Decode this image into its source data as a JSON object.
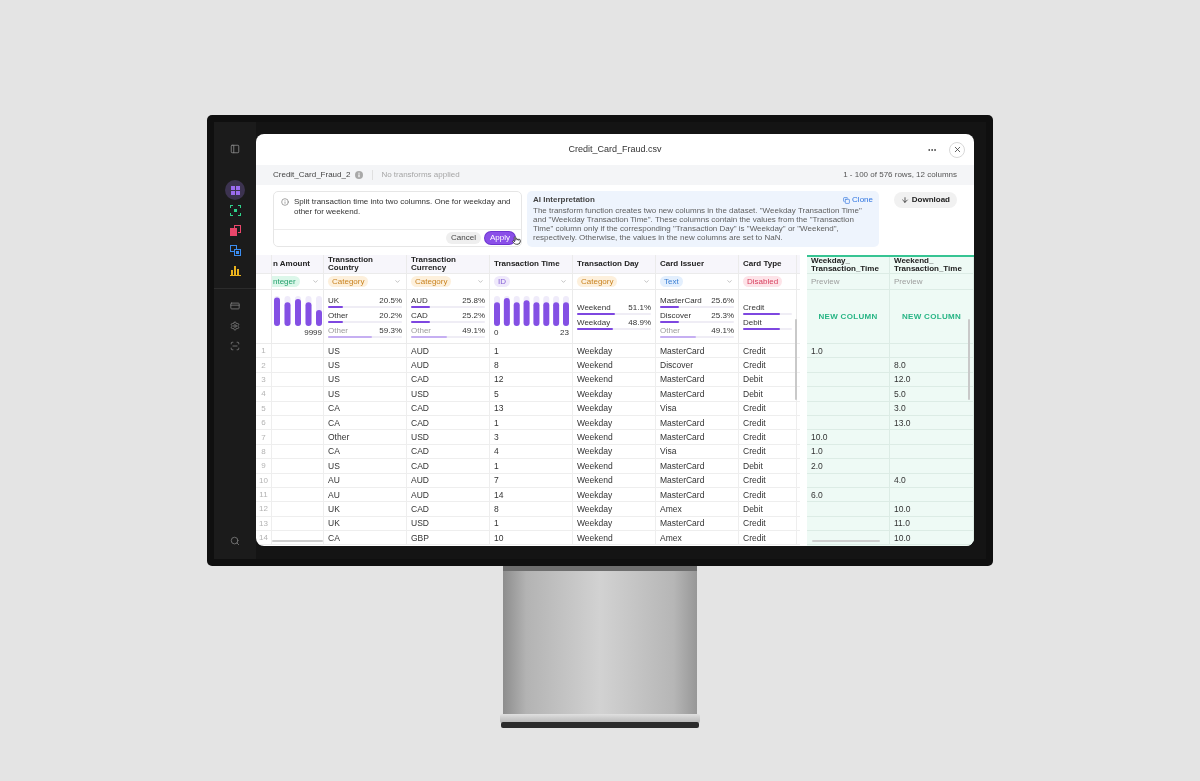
{
  "sidebar": {
    "apps": [
      {
        "selected": true,
        "color": "#9b6cf0"
      },
      {
        "selected": false,
        "color": "#2fd28a"
      },
      {
        "selected": false,
        "color": "#e8466a"
      },
      {
        "selected": false,
        "color": "#3b8df0"
      },
      {
        "selected": false,
        "color": "#e9b21d"
      }
    ]
  },
  "dialog": {
    "title": "Credit_Card_Fraud.csv"
  },
  "dataset_bar": {
    "name": "Credit_Card_Fraud_2",
    "status": "No transforms applied",
    "summary": "1 - 100 of 576 rows, 12 columns"
  },
  "prompt": {
    "text": "Split transaction time into two columns. One for weekday and other for weekend.",
    "buttons": [
      {
        "label": "Cancel",
        "kind": "secondary"
      },
      {
        "label": "Apply",
        "kind": "primary"
      }
    ]
  },
  "ai_interpretation": {
    "title": "AI Interpretation",
    "action": "Clone",
    "text": "The transform function creates two new columns in the dataset. \"Weekday Transaction Time\" and \"Weekday Transaction Time\". These columns contain the values from the \"Transaction Time\" column only if the corresponding \"Transaction Day\" is \"Weekday\" or \"Weekend\", respectively. Otherwise, the values in the new columns are set to NaN."
  },
  "download_button": {
    "label": "Download"
  },
  "table": {
    "columns": [
      {
        "name": "n Amount",
        "type": "nteger",
        "kind": "integer",
        "stats": {
          "kind": "histogram",
          "max_label": "9999"
        }
      },
      {
        "name": "Transaction Country",
        "type": "Category",
        "kind": "category",
        "stats": {
          "kind": "frequency",
          "rows": [
            {
              "label": "UK",
              "value": "20.5%",
              "level": 0.205,
              "muted": false
            },
            {
              "label": "Other",
              "value": "20.2%",
              "level": 0.202,
              "muted": false
            },
            {
              "label": "Other",
              "value": "59.3%",
              "level": 0.593,
              "muted": true
            }
          ]
        }
      },
      {
        "name": "Transaction Currency",
        "type": "Category",
        "kind": "category",
        "stats": {
          "kind": "frequency",
          "rows": [
            {
              "label": "AUD",
              "value": "25.8%",
              "level": 0.258,
              "muted": false
            },
            {
              "label": "CAD",
              "value": "25.2%",
              "level": 0.252,
              "muted": false
            },
            {
              "label": "Other",
              "value": "49.1%",
              "level": 0.491,
              "muted": true
            }
          ]
        }
      },
      {
        "name": "Transaction Time",
        "type": "ID",
        "kind": "id",
        "stats": {
          "kind": "histogram",
          "min_label": "0",
          "max_label": "23"
        }
      },
      {
        "name": "Transaction Day",
        "type": "Category",
        "kind": "category",
        "stats": {
          "kind": "frequency",
          "rows": [
            {
              "label": "Weekend",
              "value": "51.1%",
              "level": 0.511,
              "muted": false
            },
            {
              "label": "Weekday",
              "value": "48.9%",
              "level": 0.489,
              "muted": false
            }
          ]
        }
      },
      {
        "name": "Card Issuer",
        "type": "Text",
        "kind": "text",
        "stats": {
          "kind": "frequency",
          "rows": [
            {
              "label": "MasterCard",
              "value": "25.6%",
              "level": 0.256,
              "muted": false
            },
            {
              "label": "Discover",
              "value": "25.3%",
              "level": 0.253,
              "muted": false
            },
            {
              "label": "Other",
              "value": "49.1%",
              "level": 0.491,
              "muted": true
            }
          ]
        }
      },
      {
        "name": "Card Type",
        "type": "Disabled",
        "kind": "disabled",
        "stats": {
          "kind": "frequency",
          "rows": [
            {
              "label": "Credit",
              "level": 0.75,
              "muted": false
            },
            {
              "label": "Debit",
              "level": 0.75,
              "muted": false
            }
          ]
        }
      }
    ],
    "new_columns": [
      {
        "name": "Weekday_Transaction_Time",
        "type": "Preview",
        "stats": "NEW COLUMN"
      },
      {
        "name": "Weekend_Transaction_Time",
        "type": "Preview",
        "stats": "NEW COLUMN"
      }
    ],
    "rows": [
      {
        "number": "1",
        "cells": [
          null,
          "US",
          "AUD",
          "1",
          "Weekday",
          "MasterCard",
          "Credit"
        ],
        "new_cells": [
          "1.0",
          null
        ]
      },
      {
        "number": "2",
        "cells": [
          null,
          "US",
          "AUD",
          "8",
          "Weekend",
          "Discover",
          "Credit"
        ],
        "new_cells": [
          null,
          "8.0"
        ]
      },
      {
        "number": "3",
        "cells": [
          null,
          "US",
          "CAD",
          "12",
          "Weekend",
          "MasterCard",
          "Debit"
        ],
        "new_cells": [
          null,
          "12.0"
        ]
      },
      {
        "number": "4",
        "cells": [
          null,
          "US",
          "USD",
          "5",
          "Weekday",
          "MasterCard",
          "Debit"
        ],
        "new_cells": [
          null,
          "5.0"
        ]
      },
      {
        "number": "5",
        "cells": [
          null,
          "CA",
          "CAD",
          "13",
          "Weekday",
          "Visa",
          "Credit"
        ],
        "new_cells": [
          null,
          "3.0"
        ]
      },
      {
        "number": "6",
        "cells": [
          null,
          "CA",
          "CAD",
          "1",
          "Weekday",
          "MasterCard",
          "Credit"
        ],
        "new_cells": [
          null,
          "13.0"
        ]
      },
      {
        "number": "7",
        "cells": [
          null,
          "Other",
          "USD",
          "3",
          "Weekend",
          "MasterCard",
          "Credit"
        ],
        "new_cells": [
          "10.0",
          null
        ]
      },
      {
        "number": "8",
        "cells": [
          null,
          "CA",
          "CAD",
          "4",
          "Weekday",
          "Visa",
          "Credit"
        ],
        "new_cells": [
          "1.0",
          null
        ]
      },
      {
        "number": "9",
        "cells": [
          null,
          "US",
          "CAD",
          "1",
          "Weekend",
          "MasterCard",
          "Debit"
        ],
        "new_cells": [
          "2.0",
          null
        ]
      },
      {
        "number": "10",
        "cells": [
          null,
          "AU",
          "AUD",
          "7",
          "Weekend",
          "MasterCard",
          "Credit"
        ],
        "new_cells": [
          null,
          "4.0"
        ]
      },
      {
        "number": "11",
        "cells": [
          null,
          "AU",
          "AUD",
          "14",
          "Weekday",
          "MasterCard",
          "Credit"
        ],
        "new_cells": [
          "6.0",
          null
        ]
      },
      {
        "number": "12",
        "cells": [
          null,
          "UK",
          "CAD",
          "8",
          "Weekday",
          "Amex",
          "Debit"
        ],
        "new_cells": [
          null,
          "10.0"
        ]
      },
      {
        "number": "13",
        "cells": [
          null,
          "UK",
          "USD",
          "1",
          "Weekday",
          "MasterCard",
          "Credit"
        ],
        "new_cells": [
          null,
          "11.0"
        ]
      },
      {
        "number": "14",
        "cells": [
          null,
          "CA",
          "GBP",
          "10",
          "Weekend",
          "Amex",
          "Credit"
        ],
        "new_cells": [
          null,
          "10.0"
        ]
      }
    ]
  }
}
